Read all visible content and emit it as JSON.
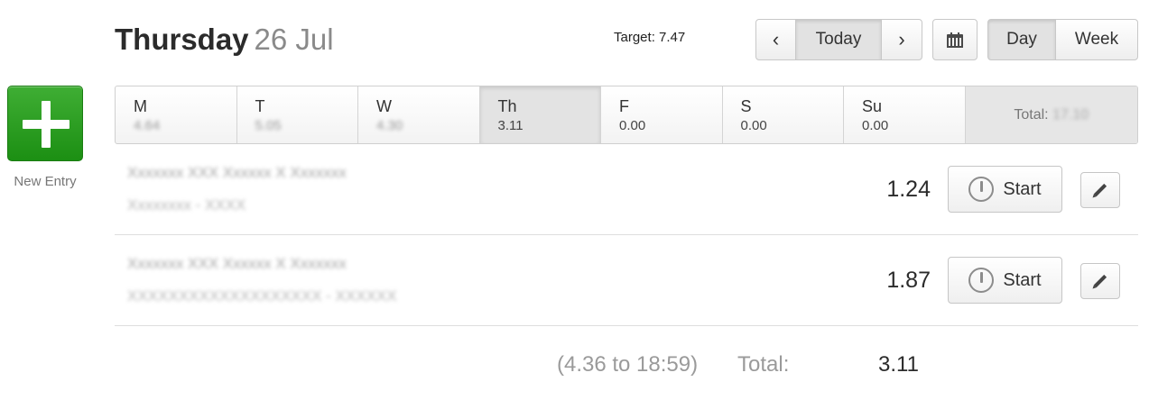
{
  "new_entry": {
    "label": "New Entry",
    "color": "#2ca326"
  },
  "header": {
    "weekday": "Thursday",
    "date": "26 Jul",
    "target": "Target: 7.47"
  },
  "nav": {
    "prev_icon": "chevron-left-icon",
    "prev_glyph": "‹",
    "today_label": "Today",
    "next_icon": "chevron-right-icon",
    "next_glyph": "›",
    "calendar_icon": "calendar-icon",
    "day_label": "Day",
    "week_label": "Week"
  },
  "week": {
    "days": [
      {
        "name": "M",
        "value": "4.64",
        "selected": false,
        "blurred": true
      },
      {
        "name": "T",
        "value": "5.05",
        "selected": false,
        "blurred": true
      },
      {
        "name": "W",
        "value": "4.30",
        "selected": false,
        "blurred": true
      },
      {
        "name": "Th",
        "value": "3.11",
        "selected": true,
        "blurred": false
      },
      {
        "name": "F",
        "value": "0.00",
        "selected": false,
        "blurred": false
      },
      {
        "name": "S",
        "value": "0.00",
        "selected": false,
        "blurred": false
      },
      {
        "name": "Su",
        "value": "0.00",
        "selected": false,
        "blurred": false
      }
    ],
    "total_label": "Total:",
    "total_value": "17.10"
  },
  "entries": [
    {
      "project": "Xxxxxxx XXX Xxxxxx X Xxxxxxx",
      "task": "Xxxxxxxx - XXXX",
      "hours": "1.24",
      "start_label": "Start"
    },
    {
      "project": "Xxxxxxx XXX Xxxxxx X Xxxxxxx",
      "task": "XXXXXXXXXXXXXXXXXXX - XXXXXX",
      "hours": "1.87",
      "start_label": "Start"
    }
  ],
  "footer": {
    "range": "(4.36 to 18:59)",
    "total_label": "Total:",
    "total_value": "3.11"
  }
}
